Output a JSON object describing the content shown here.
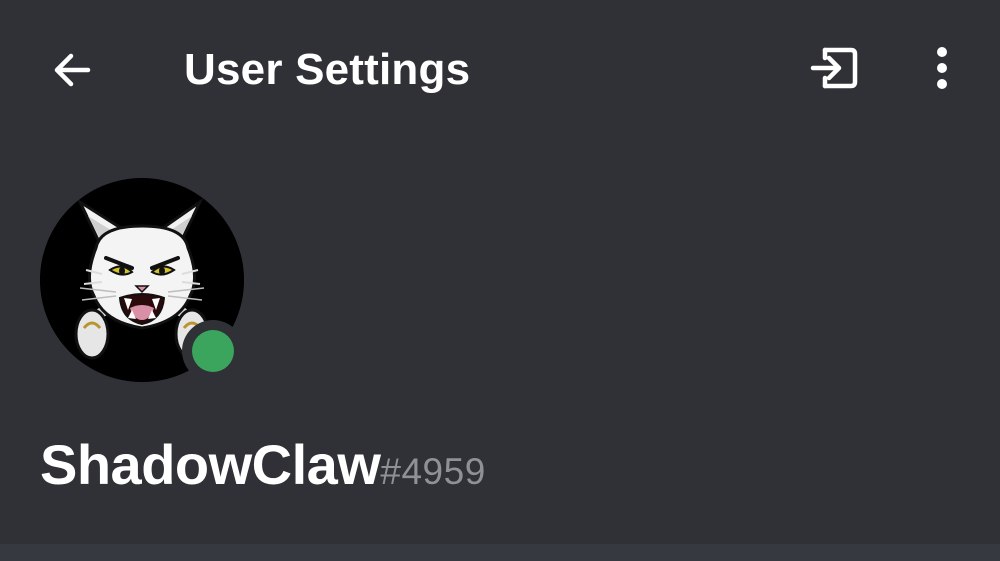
{
  "header": {
    "title": "User Settings",
    "back_icon": "arrow-left-icon",
    "logout_icon": "logout-icon",
    "more_icon": "more-vertical-icon"
  },
  "profile": {
    "username": "ShadowClaw",
    "discriminator": "#4959",
    "status": "online",
    "status_color": "#3ba55d",
    "avatar_icon": "cat-avatar-icon"
  },
  "colors": {
    "background": "#2f3136",
    "text_primary": "#ffffff",
    "text_muted": "#8e9297"
  }
}
